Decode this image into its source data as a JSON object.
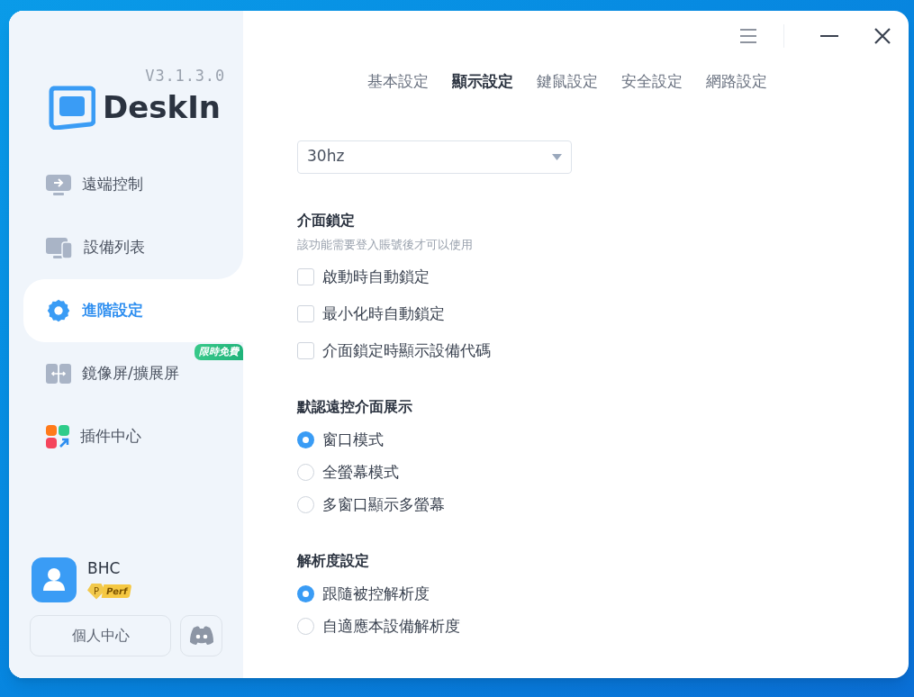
{
  "sidebar": {
    "version": "V3.1.3.0",
    "brand": "DeskIn",
    "items": [
      {
        "kind": "remote",
        "label": "遠端控制",
        "selected": false
      },
      {
        "kind": "devices",
        "label": "設備列表",
        "selected": false
      },
      {
        "kind": "settings",
        "label": "進階設定",
        "selected": true
      },
      {
        "kind": "mirror",
        "label": "鏡像屏/擴展屏",
        "selected": false,
        "badge": "限時免費"
      },
      {
        "kind": "plugins",
        "label": "插件中心",
        "selected": false
      }
    ],
    "user": {
      "name": "BHC",
      "tier_letter": "P",
      "tier": "Perf"
    },
    "profile_button": "個人中心"
  },
  "tabs": [
    {
      "label": "基本設定",
      "selected": false
    },
    {
      "label": "顯示設定",
      "selected": true
    },
    {
      "label": "鍵鼠設定",
      "selected": false
    },
    {
      "label": "安全設定",
      "selected": false
    },
    {
      "label": "網路設定",
      "selected": false
    }
  ],
  "refresh_select": {
    "value": "30hz"
  },
  "sections": [
    {
      "kind": "checkbox",
      "title": "介面鎖定",
      "note": "該功能需要登入賬號後才可以使用",
      "options": [
        {
          "label": "啟動時自動鎖定",
          "checked": false
        },
        {
          "label": "最小化時自動鎖定",
          "checked": false
        },
        {
          "label": "介面鎖定時顯示設備代碼",
          "checked": false
        }
      ]
    },
    {
      "kind": "radio",
      "title": "默認遠控介面展示",
      "options": [
        {
          "label": "窗口模式",
          "selected": true
        },
        {
          "label": "全螢幕模式",
          "selected": false
        },
        {
          "label": "多窗口顯示多螢幕",
          "selected": false
        }
      ]
    },
    {
      "kind": "radio",
      "title": "解析度設定",
      "options": [
        {
          "label": "跟隨被控解析度",
          "selected": true
        },
        {
          "label": "自適應本設備解析度",
          "selected": false
        }
      ]
    }
  ]
}
